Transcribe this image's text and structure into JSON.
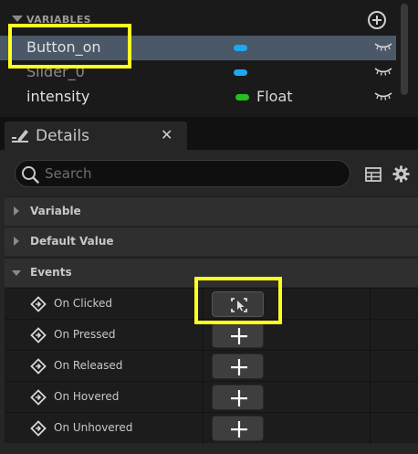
{
  "variables": {
    "header": "VARIABLES",
    "items": [
      {
        "name": "Button_on",
        "type_color": "#1ea7f2",
        "type_label": ""
      },
      {
        "name": "Slider_0",
        "type_color": "#1ea7f2",
        "type_label": ""
      },
      {
        "name": "intensity",
        "type_color": "#25c01c",
        "type_label": "Float"
      }
    ]
  },
  "details": {
    "tab_title": "Details",
    "close_glyph": "✕",
    "search_placeholder": "Search",
    "sections": {
      "variable": "Variable",
      "default_value": "Default Value",
      "events": "Events"
    },
    "events": [
      {
        "label": "On Clicked",
        "button": "goto"
      },
      {
        "label": "On Pressed",
        "button": "add"
      },
      {
        "label": "On Released",
        "button": "add"
      },
      {
        "label": "On Hovered",
        "button": "add"
      },
      {
        "label": "On Unhovered",
        "button": "add"
      }
    ]
  },
  "colors": {
    "selection": "#4a5868",
    "highlight": "#ffff22",
    "object_ref": "#1ea7f2",
    "float": "#25c01c"
  }
}
